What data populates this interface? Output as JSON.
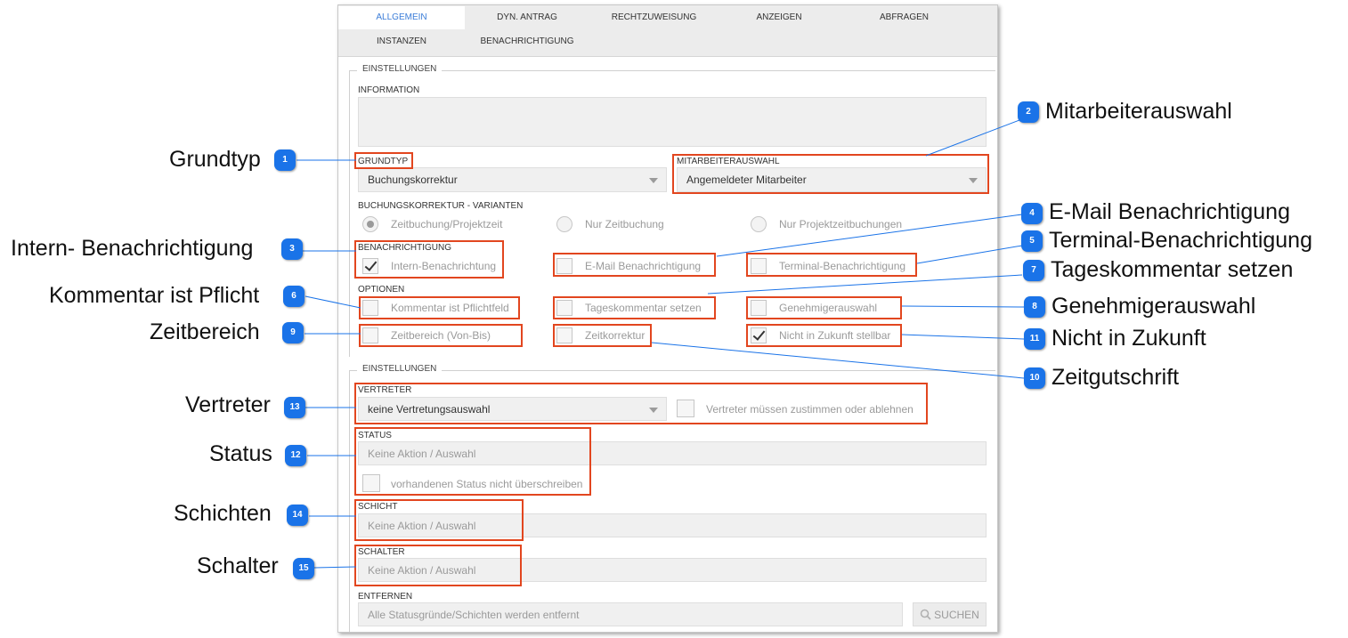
{
  "tabs": [
    {
      "label": "ALLGEMEIN",
      "active": true
    },
    {
      "label": "DYN. ANTRAG"
    },
    {
      "label": "RECHTZUWEISUNG"
    },
    {
      "label": "ANZEIGEN"
    },
    {
      "label": "ABFRAGEN"
    },
    {
      "label": "INSTANZEN"
    },
    {
      "label": "BENACHRICHTIGUNG"
    }
  ],
  "sections": {
    "einstellungen_1": "EINSTELLUNGEN",
    "einstellungen_2": "EINSTELLUNGEN"
  },
  "information": {
    "label": "INFORMATION",
    "value": ""
  },
  "grundtyp": {
    "label": "GRUNDTYP",
    "value": "Buchungskorrektur"
  },
  "mitarbeiterauswahl": {
    "label": "MITARBEITERAUSWAHL",
    "value": "Angemeldeter Mitarbeiter"
  },
  "varianten": {
    "label": "BUCHUNGSKORREKTUR - VARIANTEN",
    "options": [
      {
        "label": "Zeitbuchung/Projektzeit",
        "selected": true
      },
      {
        "label": "Nur Zeitbuchung",
        "selected": false
      },
      {
        "label": "Nur Projektzeitbuchungen",
        "selected": false
      }
    ]
  },
  "benachrichtigung": {
    "label": "BENACHRICHTIGUNG",
    "intern": {
      "label": "Intern-Benachrichtung",
      "checked": true
    },
    "email": {
      "label": "E-Mail Benachrichtigung",
      "checked": false
    },
    "terminal": {
      "label": "Terminal-Benachrichtigung",
      "checked": false
    }
  },
  "optionen": {
    "label": "OPTIONEN",
    "kommentar": {
      "label": "Kommentar ist Pflichtfeld",
      "checked": false
    },
    "tageskommentar": {
      "label": "Tageskommentar setzen",
      "checked": false
    },
    "genehmiger": {
      "label": "Genehmigerauswahl",
      "checked": false
    },
    "zeitbereich": {
      "label": "Zeitbereich (Von-Bis)",
      "checked": false
    },
    "zeitkorrektur": {
      "label": "Zeitkorrektur",
      "checked": false
    },
    "zukunft": {
      "label": "Nicht in Zukunft stellbar",
      "checked": true
    }
  },
  "vertreter": {
    "label": "VERTRETER",
    "value": "keine Vertretungsauswahl",
    "zustimmen": {
      "label": "Vertreter müssen zustimmen oder ablehnen",
      "checked": false
    }
  },
  "status": {
    "label": "STATUS",
    "value": "Keine Aktion / Auswahl",
    "nicht_ueberschreiben": {
      "label": "vorhandenen Status nicht überschreiben",
      "checked": false
    }
  },
  "schicht": {
    "label": "SCHICHT",
    "value": "Keine Aktion / Auswahl"
  },
  "schalter": {
    "label": "SCHALTER",
    "value": "Keine Aktion / Auswahl"
  },
  "entfernen": {
    "label": "ENTFERNEN",
    "value": "Alle Statusgründe/Schichten werden entfernt",
    "search_button": "SUCHEN"
  },
  "callouts": [
    {
      "num": "1",
      "text": "Grundtyp"
    },
    {
      "num": "2",
      "text": "Mitarbeiterauswahl"
    },
    {
      "num": "3",
      "text": "Intern- Benachrichtigung"
    },
    {
      "num": "4",
      "text": "E-Mail Benachrichtigung"
    },
    {
      "num": "5",
      "text": "Terminal-Benachrichtigung"
    },
    {
      "num": "6",
      "text": "Kommentar ist Pflicht"
    },
    {
      "num": "7",
      "text": "Tageskommentar setzen"
    },
    {
      "num": "8",
      "text": "Genehmigerauswahl"
    },
    {
      "num": "9",
      "text": "Zeitbereich"
    },
    {
      "num": "10",
      "text": "Zeitgutschrift"
    },
    {
      "num": "11",
      "text": "Nicht in Zukunft"
    },
    {
      "num": "12",
      "text": "Status"
    },
    {
      "num": "13",
      "text": "Vertreter"
    },
    {
      "num": "14",
      "text": "Schichten"
    },
    {
      "num": "15",
      "text": "Schalter"
    }
  ],
  "colors": {
    "accent": "#1a73e8",
    "highlight": "#e2461f",
    "tab_active": "#3b7dd8",
    "leader": "#1a73e8"
  }
}
